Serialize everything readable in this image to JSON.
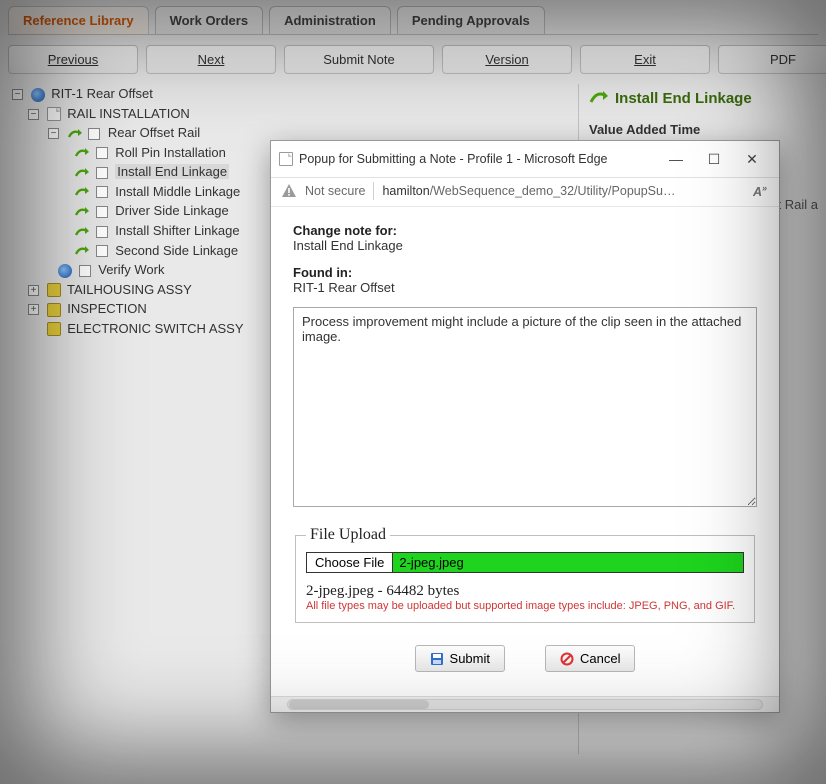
{
  "tabs": {
    "reference_library": "Reference Library",
    "work_orders": "Work Orders",
    "administration": "Administration",
    "pending_approvals": "Pending Approvals"
  },
  "toolbar": {
    "previous": "Previous",
    "next": "Next",
    "submit_note": "Submit Note",
    "version": "Version",
    "exit": "Exit",
    "pdf": "PDF"
  },
  "tree": {
    "root": "RIT-1 Rear Offset",
    "rail_installation": "RAIL INSTALLATION",
    "rear_offset_rail": "Rear Offset Rail",
    "items": [
      "Roll Pin Installation",
      "Install End Linkage",
      "Install Middle Linkage",
      "Driver Side Linkage",
      "Install Shifter Linkage",
      "Second Side Linkage"
    ],
    "verify_work": "Verify Work",
    "tailhousing": "TAILHOUSING ASSY",
    "inspection": "INSPECTION",
    "electronic_switch": "ELECTRONIC SWITCH ASSY"
  },
  "right": {
    "title": "Install End Linkage",
    "value_added_time": "Value Added Time",
    "garbled": "et Rail a"
  },
  "popup": {
    "title": "Popup for Submitting a Note - Profile 1 - Microsoft Edge",
    "not_secure": "Not secure",
    "url_host": "hamilton",
    "url_path": "/WebSequence_demo_32/Utility/PopupSu…",
    "change_note_for_label": "Change note for:",
    "change_note_for_value": "Install End Linkage",
    "found_in_label": "Found in:",
    "found_in_value": "RIT-1 Rear Offset",
    "note_text": "Process improvement might include a picture of the clip seen in the attached image.",
    "file_upload_legend": "File Upload",
    "choose_file": "Choose File",
    "chosen_filename": "2-jpeg.jpeg",
    "file_info": "2-jpeg.jpeg - 64482 bytes",
    "file_hint": "All file types may be uploaded but supported image types include: JPEG, PNG, and GIF.",
    "submit": "Submit",
    "cancel": "Cancel"
  }
}
